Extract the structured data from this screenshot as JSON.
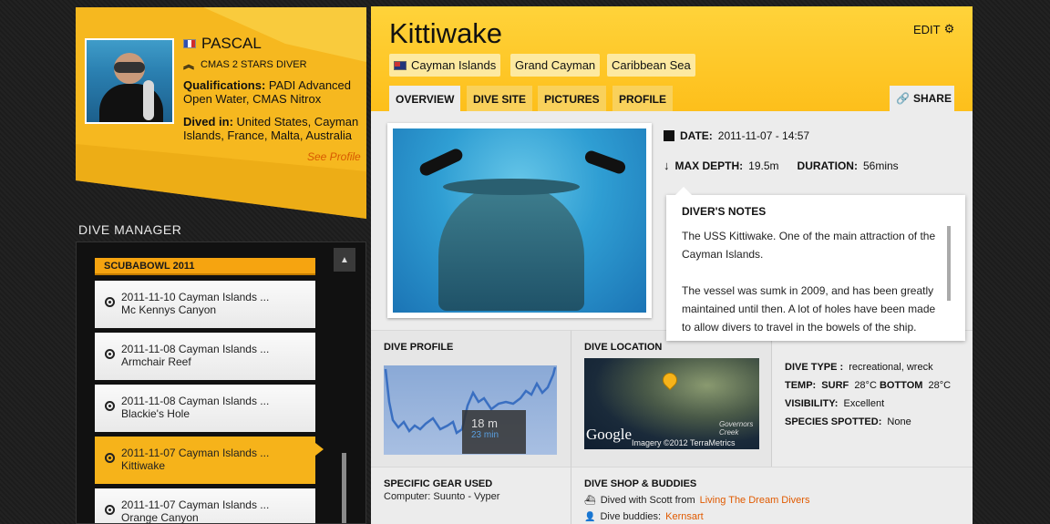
{
  "profile": {
    "name": "PASCAL",
    "rank": "CMAS 2 STARS DIVER",
    "qualifications_label": "Qualifications:",
    "qualifications_value": "PADI Advanced Open Water, CMAS Nitrox",
    "dived_in_label": "Dived in:",
    "dived_in_value": "United States, Cayman Islands, France, Malta, Australia",
    "see_profile": "See Profile",
    "flag_icon": "france-flag-icon"
  },
  "dive_manager": {
    "title": "DIVE MANAGER",
    "group": "SCUBABOWL 2011",
    "items": [
      {
        "line1": "2011-11-10 Cayman Islands ...",
        "line2": "Mc Kennys Canyon",
        "active": false
      },
      {
        "line1": "2011-11-08 Cayman Islands ...",
        "line2": "Armchair Reef",
        "active": false
      },
      {
        "line1": "2011-11-08 Cayman Islands ...",
        "line2": "Blackie's Hole",
        "active": false
      },
      {
        "line1": "2011-11-07 Cayman Islands ...",
        "line2": "Kittiwake",
        "active": true
      },
      {
        "line1": "2011-11-07 Cayman Islands ...",
        "line2": "Orange Canyon",
        "active": false
      }
    ],
    "scroll_up_icon": "▲"
  },
  "dive": {
    "title": "Kittiwake",
    "edit_label": "EDIT",
    "chips": [
      "Cayman Islands",
      "Grand Cayman",
      "Caribbean Sea"
    ],
    "tabs": [
      "OVERVIEW",
      "DIVE SITE",
      "PICTURES",
      "PROFILE"
    ],
    "active_tab": "OVERVIEW",
    "share_label": "SHARE",
    "date_label": "DATE:",
    "date_value": "2011-11-07 - 14:57",
    "max_depth_label": "MAX DEPTH:",
    "max_depth_value": "19.5m",
    "duration_label": "DURATION:",
    "duration_value": "56mins"
  },
  "notes": {
    "title": "DIVER'S NOTES",
    "para1": "The USS Kittiwake. One of the main attraction of the Cayman Islands.",
    "para2": "The vessel was sumk in 2009, and has been greatly maintained until then. A lot of holes have been made to allow divers to travel in the bowels of the ship."
  },
  "dive_profile": {
    "title": "DIVE PROFILE",
    "tooltip_depth": "18 m",
    "tooltip_time": "23 min"
  },
  "dive_location": {
    "title": "DIVE LOCATION",
    "google": "Google",
    "credit": "Imagery ©2012 TerraMetrics",
    "place_label": "Governors Creek"
  },
  "dive_details": {
    "type_label": "DIVE TYPE :",
    "type_value": "recreational, wreck",
    "temp_label": "TEMP:",
    "surf_label": "SURF",
    "surf_value": "28°C",
    "bottom_label": "BOTTOM",
    "bottom_value": "28°C",
    "visibility_label": "VISIBILITY:",
    "visibility_value": "Excellent",
    "species_label": "SPECIES SPOTTED:",
    "species_value": "None"
  },
  "gear": {
    "title": "SPECIFIC GEAR USED",
    "value": "Computer: Suunto - Vyper"
  },
  "shop": {
    "title": "DIVE SHOP & BUDDIES",
    "dived_with_prefix": "Dived with Scott from",
    "dived_with_link": "Living The Dream Divers",
    "buddies_prefix": "Dive buddies:",
    "buddies_link": "Kernsart"
  }
}
